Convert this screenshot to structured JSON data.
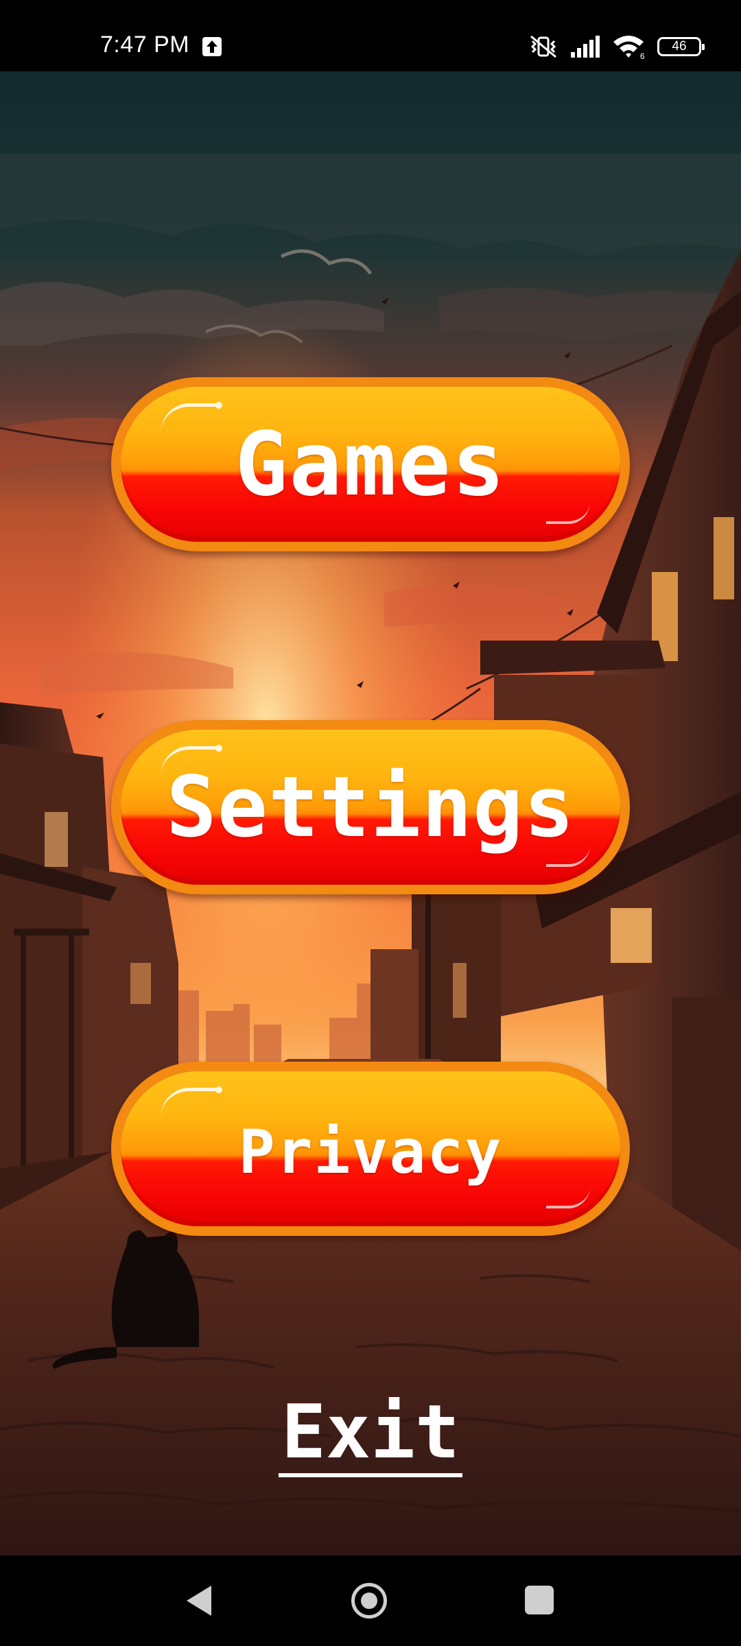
{
  "status_bar": {
    "time": "7:47 PM",
    "upload_icon": "upload-arrow-icon",
    "mute_icon": "vibrate-off-icon",
    "signal_icon": "cellular-signal-icon",
    "wifi_icon": "wifi-icon",
    "wifi_badge": "6",
    "battery_level": "46"
  },
  "menu": {
    "games_label": "Games",
    "settings_label": "Settings",
    "privacy_label": "Privacy",
    "exit_label": "Exit"
  },
  "colors": {
    "button_rim": "#f38a12",
    "button_top": "#ffc21a",
    "button_bottom": "#f80505",
    "sky_top": "#173033",
    "sunset": "#f06a35"
  },
  "nav_bar": {
    "back_icon": "back-triangle-icon",
    "home_icon": "home-circle-icon",
    "recents_icon": "recents-square-icon"
  }
}
